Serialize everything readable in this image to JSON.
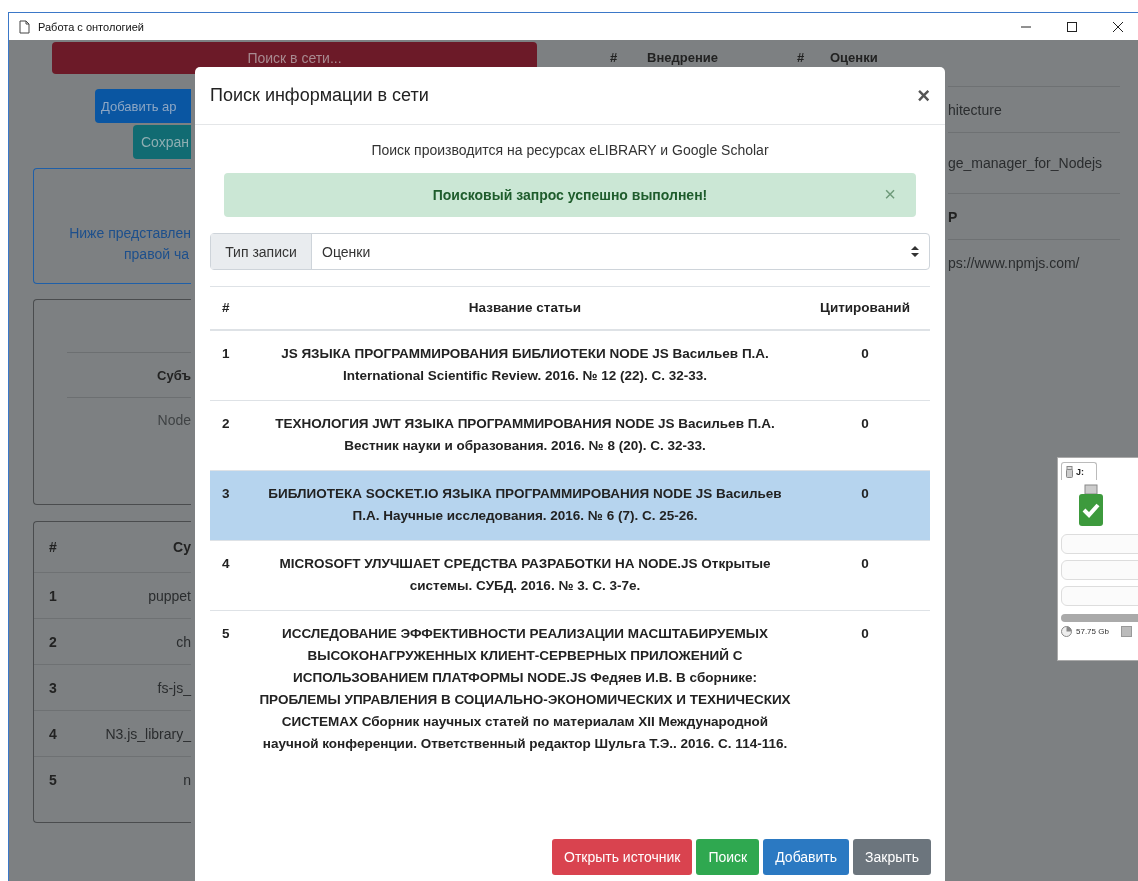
{
  "window": {
    "title": "Работа с онтологией"
  },
  "background": {
    "search_button": "Поиск в сети...",
    "add_button": "Добавить ар",
    "save_button": "Сохран",
    "info_lines": [
      "Ниже представлен",
      "правой ча"
    ],
    "subject_card": {
      "header": "Субъ",
      "value": "Node"
    },
    "left_table": {
      "columns": [
        "#",
        "Су"
      ],
      "rows": [
        {
          "num": "1",
          "value": "puppet"
        },
        {
          "num": "2",
          "value": "ch"
        },
        {
          "num": "3",
          "value": "fs-js_"
        },
        {
          "num": "4",
          "value": "N3.js_library_"
        },
        {
          "num": "5",
          "value": "n"
        }
      ]
    },
    "right_headers": [
      "#",
      "Внедрение",
      "#",
      "Оценки"
    ],
    "right_cells": [
      "hitecture",
      "ge_manager_for_Nodejs"
    ],
    "right_header_2": "P",
    "right_cell_2": "ps://www.npmjs.com/"
  },
  "dialog": {
    "title": "Поиск информации в сети",
    "close": "×",
    "info": "Поиск производится на ресурсах eLIBRARY и Google Scholar",
    "alert": {
      "text": "Поисковый запрос успешно выполнен!",
      "close": "×"
    },
    "record_type": {
      "label": "Тип записи",
      "value": "Оценки"
    },
    "table": {
      "columns": [
        "#",
        "Название статьи",
        "Цитирований"
      ],
      "rows": [
        {
          "num": "1",
          "title": "JS ЯЗЫКА ПРОГРАММИРОВАНИЯ БИБЛИОТЕКИ NODE JS Васильев П.А. International Scientific Review. 2016. № 12 (22). С. 32-33.",
          "citations": "0",
          "selected": false
        },
        {
          "num": "2",
          "title": "ТЕХНОЛОГИЯ JWT ЯЗЫКА ПРОГРАММИРОВАНИЯ NODE JS Васильев П.А. Вестник науки и образования. 2016. № 8 (20). С. 32-33.",
          "citations": "0",
          "selected": false
        },
        {
          "num": "3",
          "title": "БИБЛИОТЕКА SOCKET.IO ЯЗЫКА ПРОГРАММИРОВАНИЯ NODE JS Васильев П.А. Научные исследования. 2016. № 6 (7). С. 25-26.",
          "citations": "0",
          "selected": true
        },
        {
          "num": "4",
          "title": "MICROSOFT УЛУЧШАЕТ СРЕДСТВА РАЗРАБОТКИ НА NODE.JS Открытые системы. СУБД. 2016. № 3. С. 3-7е.",
          "citations": "0",
          "selected": false
        },
        {
          "num": "5",
          "title": "ИССЛЕДОВАНИЕ ЭФФЕКТИВНОСТИ РЕАЛИЗАЦИИ МАСШТАБИРУЕМЫХ ВЫСОКОНАГРУЖЕННЫХ КЛИЕНТ-СЕРВЕРНЫХ ПРИЛОЖЕНИЙ С ИСПОЛЬЗОВАНИЕМ ПЛАТФОРМЫ NODE.JS Федяев И.В. В сборнике: ПРОБЛЕМЫ УПРАВЛЕНИЯ В СОЦИАЛЬНО-ЭКОНОМИЧЕСКИХ И ТЕХНИЧЕСКИХ СИСТЕМАХ Сборник научных статей по материалам XII Международной научной конференции. Ответственный редактор Шульга Т.Э.. 2016. С. 114-116.",
          "citations": "0",
          "selected": false
        }
      ]
    },
    "buttons": [
      {
        "label": "Открыть источник",
        "kind": "danger"
      },
      {
        "label": "Поиск",
        "kind": "success"
      },
      {
        "label": "Добавить",
        "kind": "primary"
      },
      {
        "label": "Закрыть",
        "kind": "secondary"
      }
    ]
  },
  "drive_widget": {
    "tab": "J:",
    "size": "57.75 Gb"
  }
}
